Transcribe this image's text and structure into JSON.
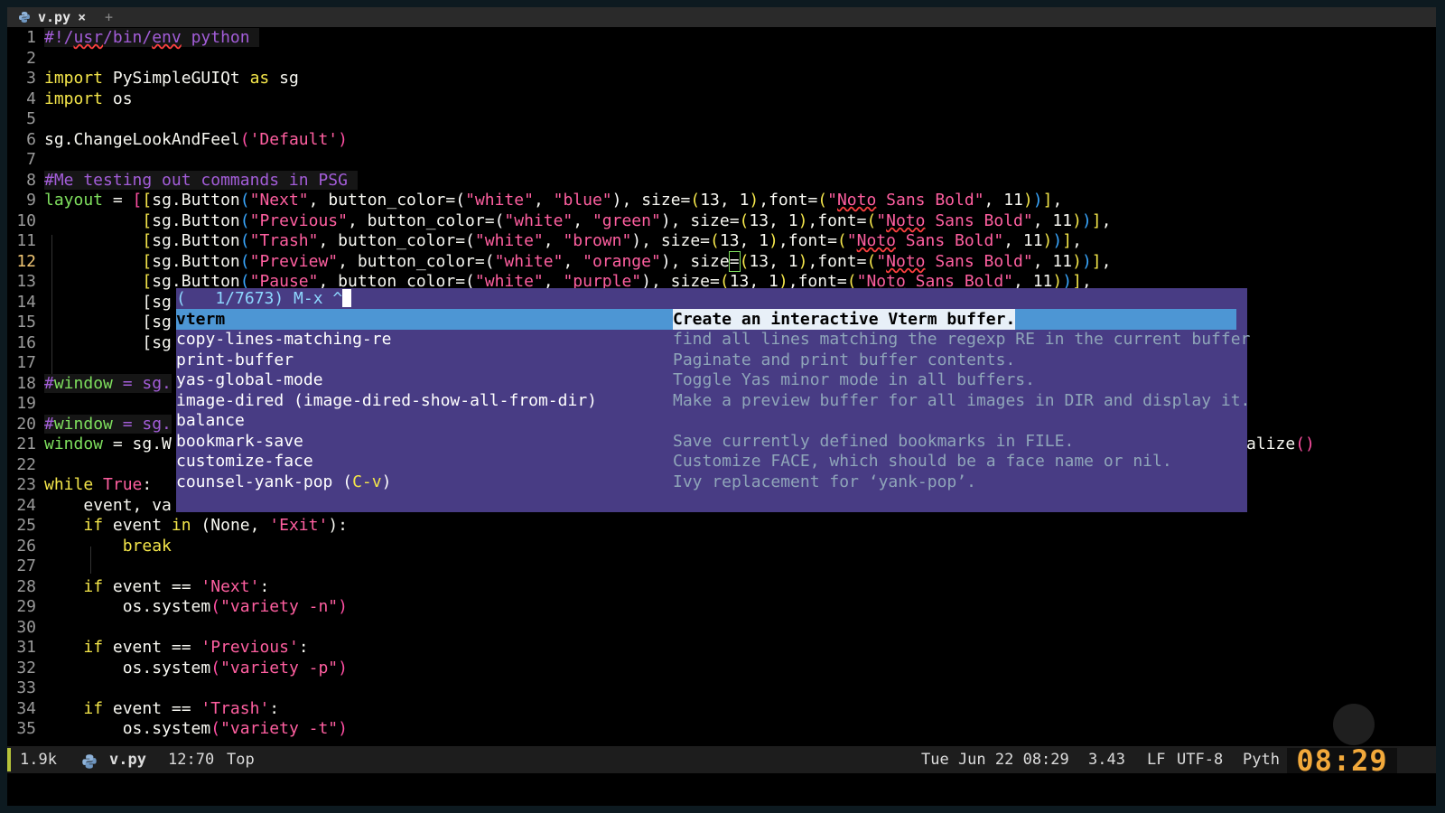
{
  "tab": {
    "title": "v.py",
    "close": "×",
    "new": "+"
  },
  "editor": {
    "lines": [
      {
        "n": "1"
      },
      {
        "n": "2"
      },
      {
        "n": "3"
      },
      {
        "n": "4"
      },
      {
        "n": "5"
      },
      {
        "n": "6"
      },
      {
        "n": "7"
      },
      {
        "n": "8"
      },
      {
        "n": "9"
      },
      {
        "n": "10"
      },
      {
        "n": "11"
      },
      {
        "n": "12"
      },
      {
        "n": "13"
      },
      {
        "n": "14"
      },
      {
        "n": "15"
      },
      {
        "n": "16"
      },
      {
        "n": "17"
      },
      {
        "n": "18"
      },
      {
        "n": "19"
      },
      {
        "n": "20"
      },
      {
        "n": "21"
      },
      {
        "n": "22"
      },
      {
        "n": "23"
      },
      {
        "n": "24"
      },
      {
        "n": "25"
      },
      {
        "n": "26"
      },
      {
        "n": "27"
      },
      {
        "n": "28"
      },
      {
        "n": "29"
      },
      {
        "n": "30"
      },
      {
        "n": "31"
      },
      {
        "n": "32"
      },
      {
        "n": "33"
      },
      {
        "n": "34"
      },
      {
        "n": "35"
      }
    ],
    "text": {
      "l1a": "#!/",
      "l1b": "usr",
      "l1c": "/bin/",
      "l1d": "env",
      "l1e": " python ",
      "l3a": "import",
      "l3b": " PySimpleGUIQt ",
      "l3c": "as",
      "l3d": " sg",
      "l4a": "import",
      "l4b": " os",
      "l6a": "sg.ChangeLookAndFeel",
      "l6b": "(",
      "l6c": "'Default'",
      "l6d": ")",
      "l8": "#Me testing out commands in PSG ",
      "l9var": "layout",
      "l9eq": " = ",
      "l18a": "#",
      "l18b": "window",
      "l18c": " = sg.",
      "l20a": "#",
      "l20b": "window",
      "l20c": " = sg.",
      "l21a": "window",
      "l21b": " = sg.W",
      "l21tail": "alize",
      "l21paren": "()",
      "l23a": "while",
      "l23b": " True",
      "l23c": ":",
      "l24": "event, va",
      "l25a": "if",
      "l25b": " event ",
      "l25c": "in",
      "l25d": " (None, ",
      "l25e": "'Exit'",
      "l25f": "):",
      "l26": "break",
      "l28a": "if",
      "l28b": " event == ",
      "l28c": "'Next'",
      "l28d": ":",
      "l29a": "os.system",
      "l29b": "(",
      "l29c": "\"variety -n\"",
      "l29d": ")",
      "l31a": "if",
      "l31b": " event == ",
      "l31c": "'Previous'",
      "l31d": ":",
      "l32a": "os.system",
      "l32b": "(",
      "l32c": "\"variety -p\"",
      "l32d": ")",
      "l34a": "if",
      "l34b": " event == ",
      "l34c": "'Trash'",
      "l34d": ":",
      "l35a": "os.system",
      "l35b": "(",
      "l35c": "\"variety -t\"",
      "l35d": ")",
      "sg": "[sg",
      "sgB": "sg.Button",
      "comma": ", ",
      "bc": "button_color=",
      "white": "\"white\"",
      "size": "size=",
      "size12": "size",
      "sz": "13, 1",
      "font": "font=",
      "fq": "\"",
      "noto": "Noto",
      "sansbold": " Sans Bold\"",
      "eleven": ", 11",
      "next": "\"Next\"",
      "blue": "\"blue\"",
      "previous": "\"Previous\"",
      "green": "\"green\"",
      "trash": "\"Trash\"",
      "brown": "\"brown\"",
      "preview": "\"Preview\"",
      "orange": "\"orange\"",
      "pause": "\"Pause\"",
      "purple": "\"purple\"",
      "l13tail": "11))],"
    }
  },
  "ivy": {
    "prompt": "(   1/7673) M-x ^",
    "items": [
      {
        "name": "vterm",
        "desc": "Create an interactive Vterm buffer."
      },
      {
        "name": "copy-lines-matching-re",
        "desc": "find all lines matching the regexp RE in the current buffer"
      },
      {
        "name": "print-buffer",
        "desc": "Paginate and print buffer contents."
      },
      {
        "name": "yas-global-mode",
        "desc": "Toggle Yas minor mode in all buffers."
      },
      {
        "name": "image-dired (image-dired-show-all-from-dir)",
        "desc": "Make a preview buffer for all images in DIR and display it."
      },
      {
        "name": "balance",
        "desc": ""
      },
      {
        "name": "bookmark-save",
        "desc": "Save currently defined bookmarks in FILE."
      },
      {
        "name": "customize-face",
        "desc": "Customize FACE, which should be a face name or nil."
      },
      {
        "name": "counsel-yank-pop",
        "key_open": " (",
        "key": "C-v",
        "key_close": ")",
        "desc": "Ivy replacement for ‘yank-pop’."
      }
    ]
  },
  "modeline": {
    "size": "1.9k",
    "file": "v.py",
    "position": "12:70",
    "scroll": "Top",
    "datetime": "Tue Jun 22 08:29",
    "load": "3.43",
    "eol": "LF",
    "encoding": "UTF-8",
    "mode": "Pyth",
    "clock": "08:29"
  },
  "colors": {
    "keyword": "#f4e64a",
    "string": "#ff5fa0",
    "comment": "#a35dd8",
    "ivy_bg": "#483c84",
    "ivy_selection": "#4d96d4",
    "clock": "#f2a93b"
  }
}
